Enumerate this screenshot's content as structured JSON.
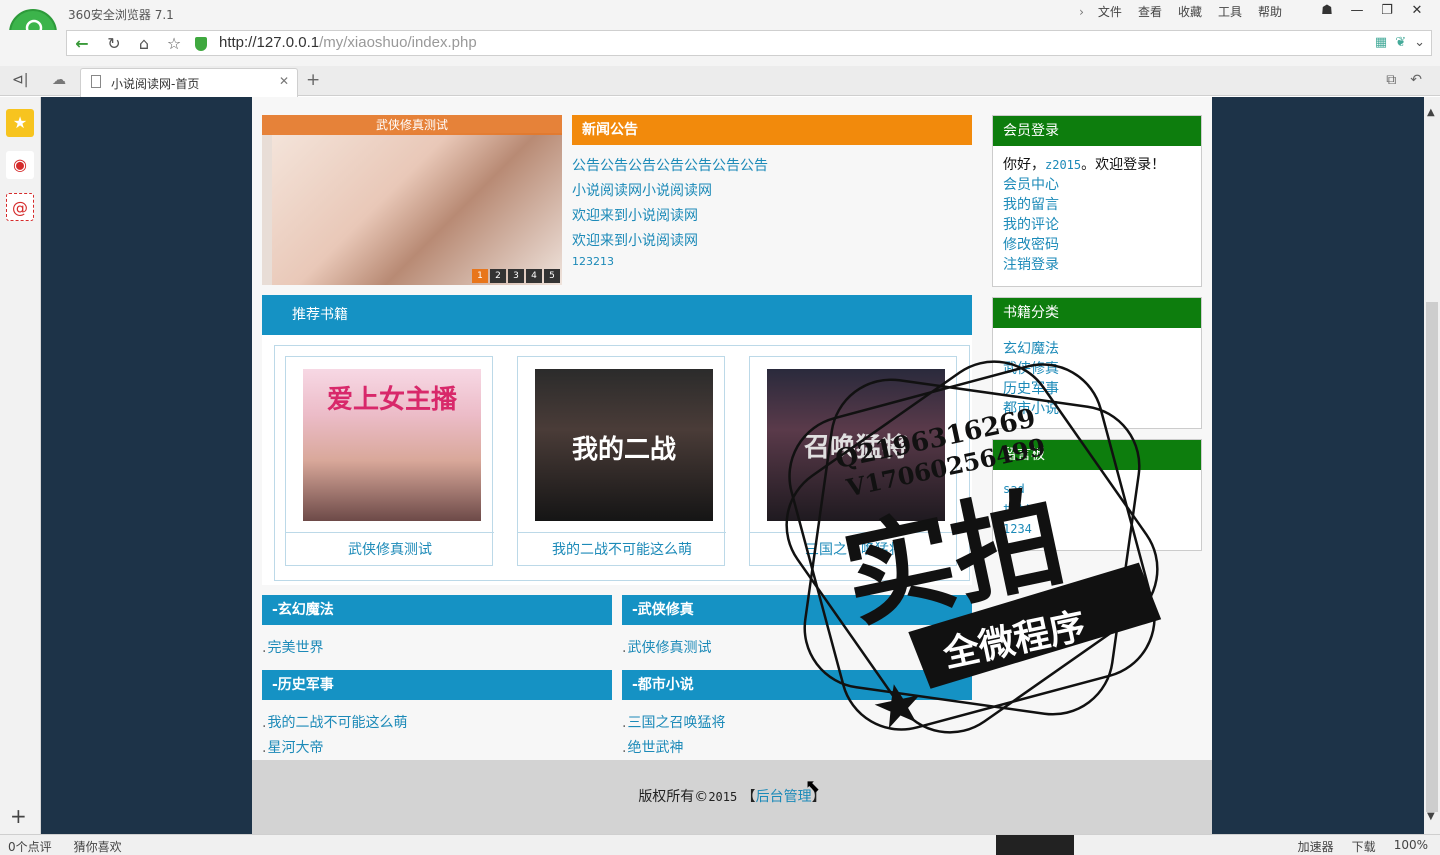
{
  "browser": {
    "name": "360安全浏览器 7.1",
    "menu": [
      "文件",
      "查看",
      "收藏",
      "工具",
      "帮助"
    ],
    "url_host": "http://127.0.0.1",
    "url_path": "/my/xiaoshuo/index.php",
    "tab_title": "小说阅读网-首页"
  },
  "statusbar": {
    "left": [
      "0个点评",
      "猜你喜欢"
    ],
    "right": [
      "加速器",
      "下载",
      "100%"
    ]
  },
  "slider": {
    "caption": "武侠修真测试",
    "dots": [
      "1",
      "2",
      "3",
      "4",
      "5"
    ]
  },
  "news": {
    "title": "新闻公告",
    "items": [
      "公告公告公告公告公告公告公告",
      "小说阅读网小说阅读网",
      "欢迎来到小说阅读网",
      "欢迎来到小说阅读网",
      "123213"
    ]
  },
  "recommend": {
    "title": "推荐书籍",
    "books": [
      {
        "name": "武侠修真测试",
        "cover_text": "爱上女主播"
      },
      {
        "name": "我的二战不可能这么萌",
        "cover_text": "我的二战"
      },
      {
        "name": "三国之召唤猛将",
        "cover_text": "召唤猛将"
      }
    ]
  },
  "categories": [
    {
      "title": "-玄幻魔法",
      "items": [
        "完美世界"
      ]
    },
    {
      "title": "-武侠修真",
      "items": [
        "武侠修真测试"
      ]
    },
    {
      "title": "-历史军事",
      "items": [
        "我的二战不可能这么萌",
        "星河大帝"
      ]
    },
    {
      "title": "-都市小说",
      "items": [
        "三国之召唤猛将",
        "绝世武神"
      ]
    }
  ],
  "login": {
    "title": "会员登录",
    "greet_pre": "你好，",
    "user": "z2015",
    "greet_post": "。欢迎登录！",
    "links": [
      "会员中心",
      "我的留言",
      "我的评论",
      "修改密码",
      "注销登录"
    ]
  },
  "book_categories": {
    "title": "书籍分类",
    "items": [
      "玄幻魔法",
      "武侠修真",
      "历史军事",
      "都市小说"
    ]
  },
  "guestbook": {
    "title": "留言板",
    "items": [
      "sad",
      "tttt",
      "1234"
    ]
  },
  "footer": {
    "text": "版权所有©",
    "year": "2015",
    "bracket_open": " 【",
    "admin_link": "后台管理",
    "bracket_close": "】"
  },
  "watermark": {
    "line1": "Q2196316269",
    "line2": "V17060256499",
    "big": "实拍",
    "banner": "全微程序"
  }
}
